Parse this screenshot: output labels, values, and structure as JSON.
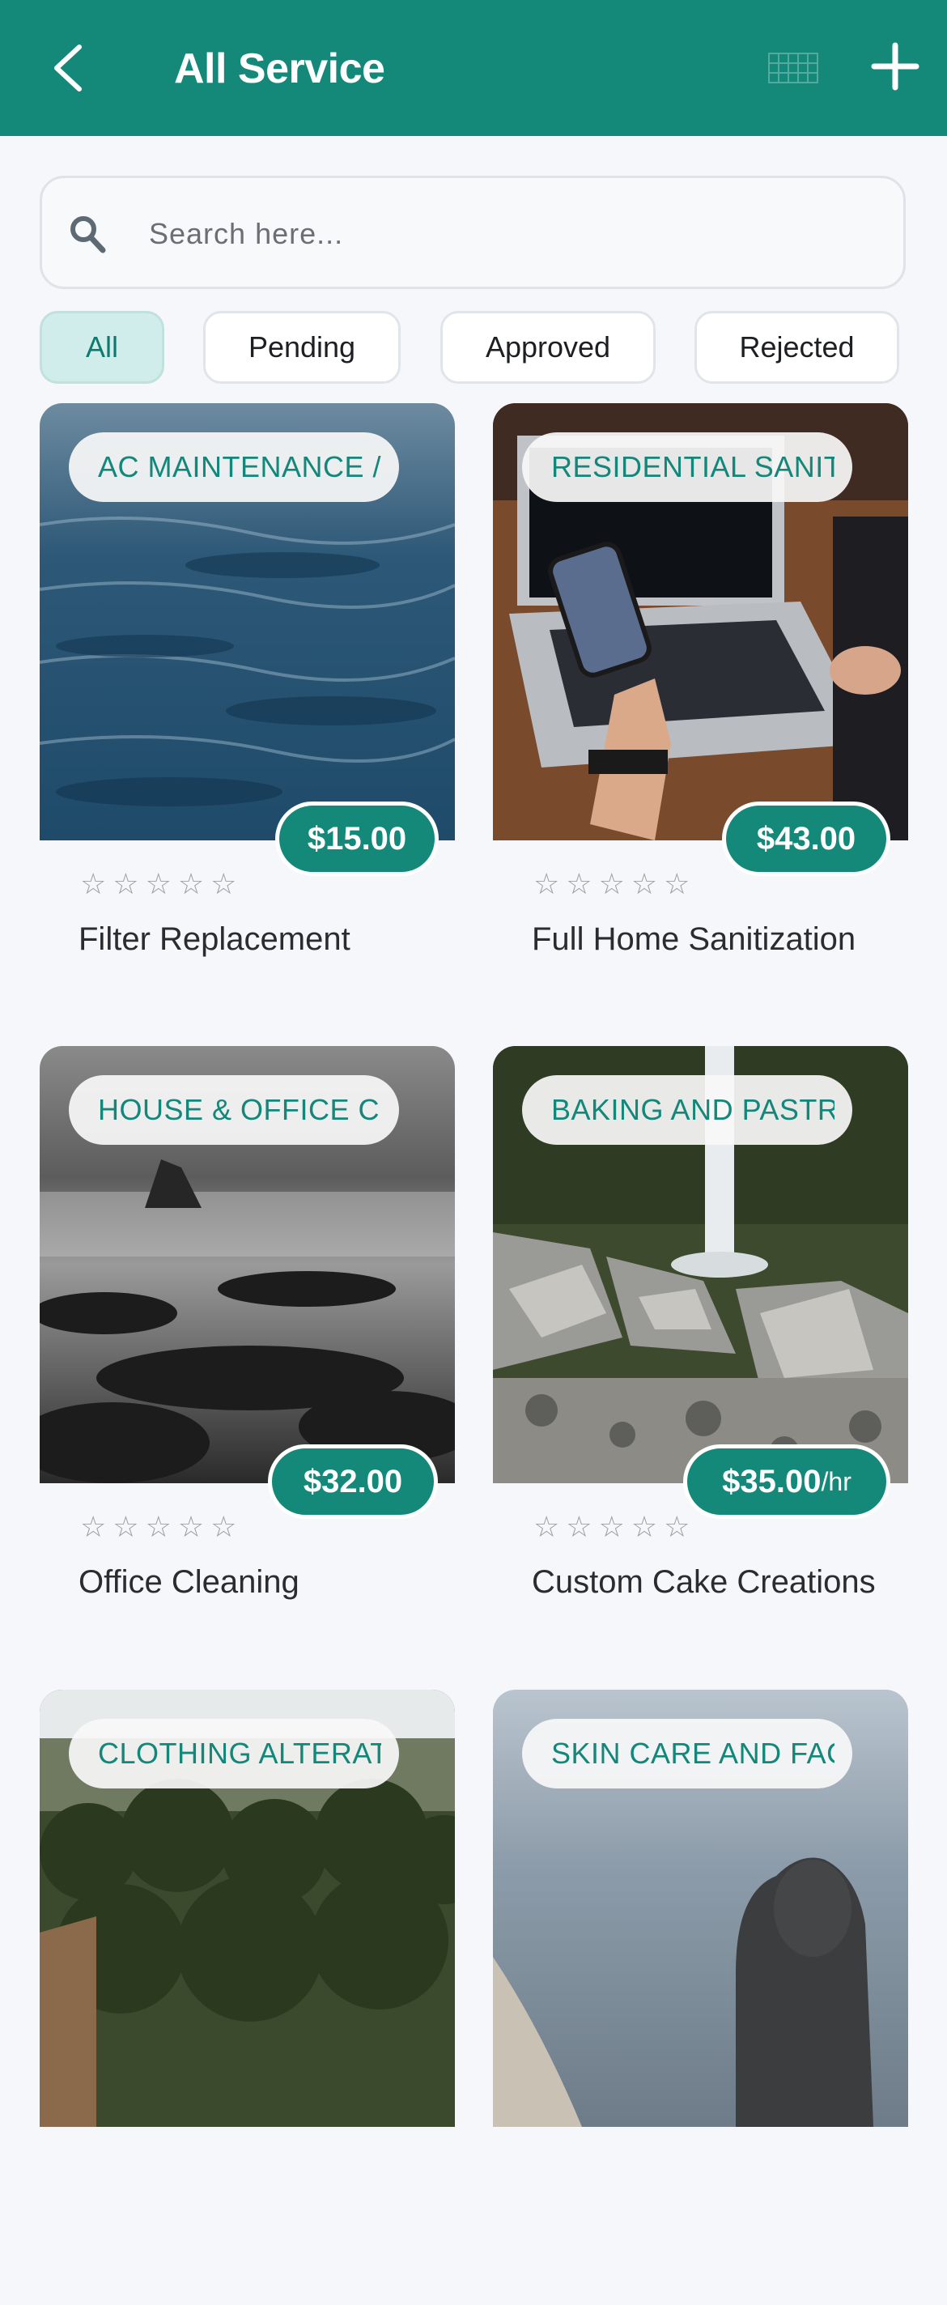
{
  "appbar": {
    "title": "All Service"
  },
  "search": {
    "placeholder": "Search here..."
  },
  "filters": [
    "All",
    "Pending",
    "Approved",
    "Rejected"
  ],
  "colors": {
    "primary": "#14897a",
    "chip_active_bg": "#d0edeb",
    "background": "#f5f7fa"
  },
  "icons": {
    "back": "chevron-left-icon",
    "grid": "grid-icon",
    "add": "plus-icon",
    "search": "search-icon",
    "star": "star-outline-icon"
  },
  "services": [
    {
      "category": "AC MAINTENANCE / REPAIR",
      "price": "$15.00",
      "unit": "",
      "rating": 0,
      "name": "Filter Replacement"
    },
    {
      "category": "RESIDENTIAL SANITIZATION",
      "price": "$43.00",
      "unit": "",
      "rating": 0,
      "name": "Full Home Sanitization"
    },
    {
      "category": "HOUSE & OFFICE CLEANING",
      "price": "$32.00",
      "unit": "",
      "rating": 0,
      "name": "Office Cleaning"
    },
    {
      "category": "BAKING AND PASTRY",
      "price": "$35.00",
      "unit": "/hr",
      "rating": 0,
      "name": "Custom Cake Creations"
    },
    {
      "category": "CLOTHING ALTERATIONS",
      "price": "",
      "unit": "",
      "rating": 0,
      "name": ""
    },
    {
      "category": "SKIN CARE AND FACIAL",
      "price": "",
      "unit": "",
      "rating": 0,
      "name": ""
    }
  ]
}
